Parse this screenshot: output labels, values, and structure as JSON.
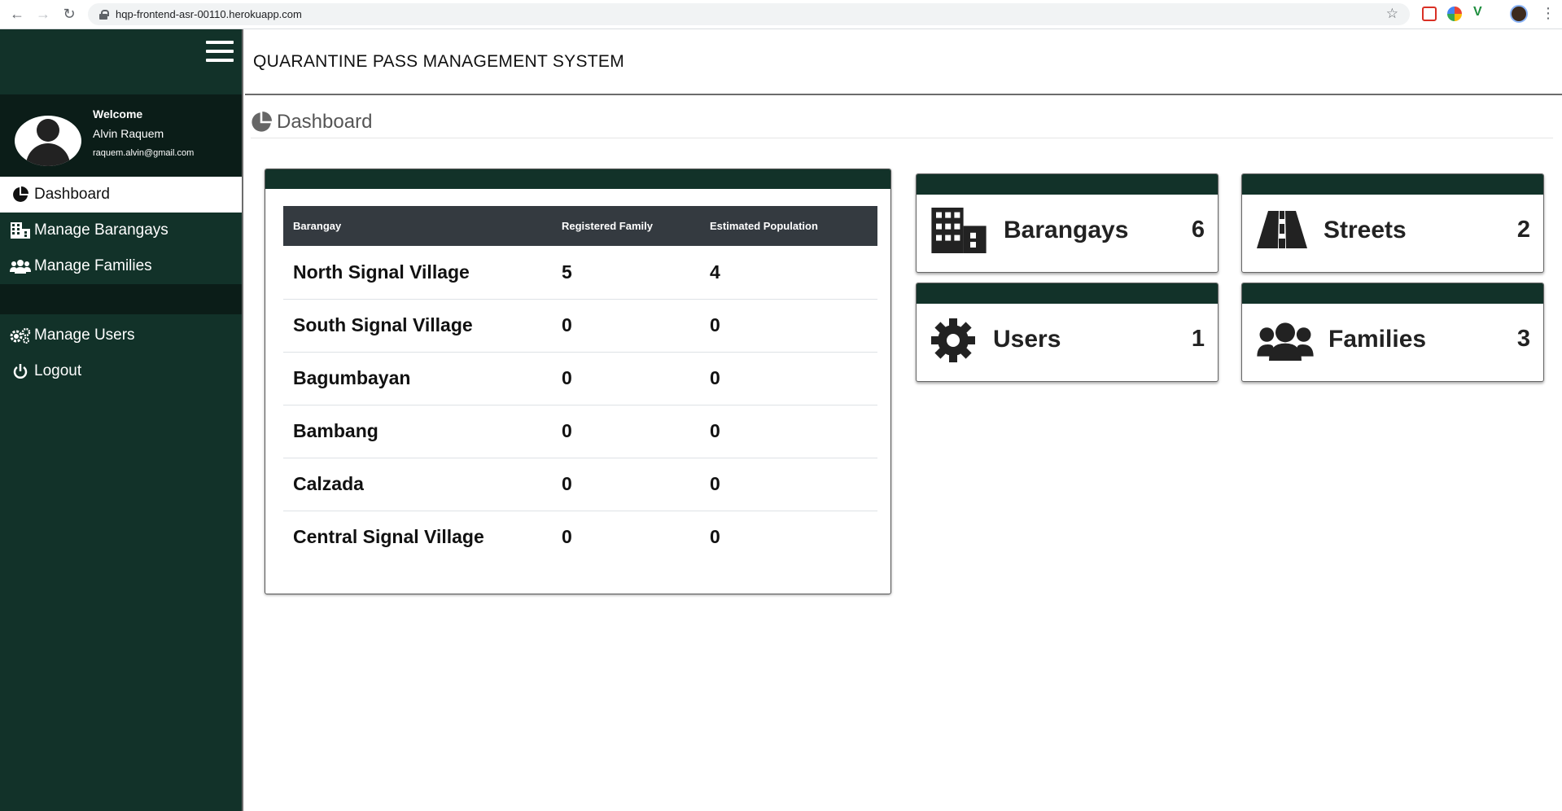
{
  "browser": {
    "url": "hqp-frontend-asr-00110.herokuapp.com"
  },
  "app": {
    "title": "QUARANTINE PASS MANAGEMENT SYSTEM"
  },
  "user": {
    "welcome": "Welcome",
    "name": "Alvin Raquem",
    "email": "raquem.alvin@gmail.com"
  },
  "sidebar": {
    "items": [
      {
        "label": "Dashboard",
        "icon": "chart-pie-icon"
      },
      {
        "label": "Manage Barangays",
        "icon": "building-icon"
      },
      {
        "label": "Manage Families",
        "icon": "users-icon"
      },
      {
        "label": "Manage Users",
        "icon": "cogs-icon"
      },
      {
        "label": "Logout",
        "icon": "power-icon"
      }
    ]
  },
  "page": {
    "title": "Dashboard"
  },
  "table": {
    "headers": [
      "Barangay",
      "Registered Family",
      "Estimated Population"
    ],
    "rows": [
      [
        "North Signal Village",
        "5",
        "4"
      ],
      [
        "South Signal Village",
        "0",
        "0"
      ],
      [
        "Bagumbayan",
        "0",
        "0"
      ],
      [
        "Bambang",
        "0",
        "0"
      ],
      [
        "Calzada",
        "0",
        "0"
      ],
      [
        "Central Signal Village",
        "0",
        "0"
      ]
    ]
  },
  "stats": {
    "barangays": {
      "label": "Barangays",
      "value": "6",
      "icon": "building-icon"
    },
    "streets": {
      "label": "Streets",
      "value": "2",
      "icon": "road-icon"
    },
    "users": {
      "label": "Users",
      "value": "1",
      "icon": "cog-icon"
    },
    "families": {
      "label": "Families",
      "value": "3",
      "icon": "users-icon"
    }
  },
  "colors": {
    "sidebar": "#123229",
    "sidebar_dark": "#0b1d18",
    "table_header": "#343a40"
  }
}
